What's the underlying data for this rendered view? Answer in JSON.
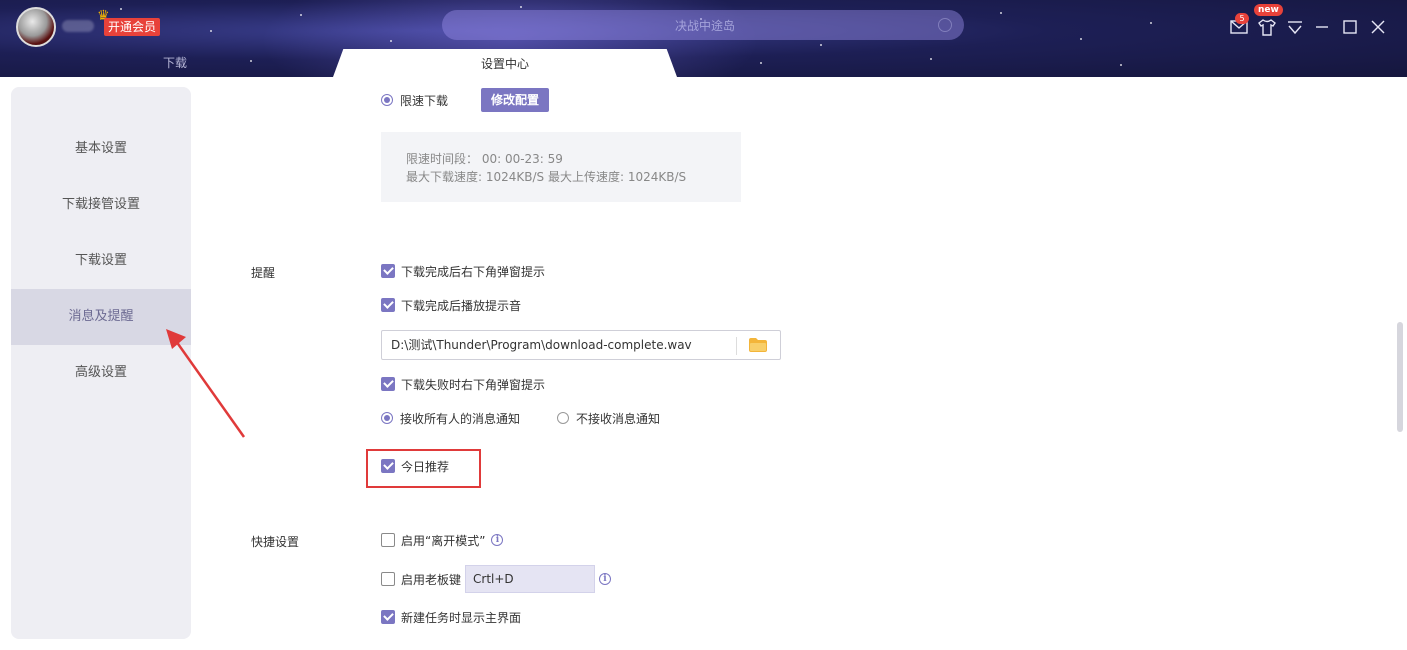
{
  "header": {
    "vip_label": "开通会员",
    "search_placeholder": "决战中途岛",
    "message_count": "5",
    "new_badge": "new"
  },
  "tabs": [
    {
      "label": "下载",
      "active": false
    },
    {
      "label": "设置中心",
      "active": true
    }
  ],
  "sidebar": {
    "items": [
      {
        "label": "基本设置",
        "active": false
      },
      {
        "label": "下载接管设置",
        "active": false
      },
      {
        "label": "下载设置",
        "active": false
      },
      {
        "label": "消息及提醒",
        "active": true
      },
      {
        "label": "高级设置",
        "active": false
      }
    ]
  },
  "speed": {
    "radio_label": "限速下载",
    "config_button": "修改配置",
    "time_range": "限速时间段： 00: 00-23: 59",
    "max_speeds": "最大下载速度: 1024KB/S   最大上传速度: 1024KB/S"
  },
  "reminders": {
    "section_label": "提醒",
    "popup_on_complete": "下载完成后右下角弹窗提示",
    "sound_on_complete": "下载完成后播放提示音",
    "sound_path": "D:\\测试\\Thunder\\Program\\download-complete.wav",
    "popup_on_fail": "下载失败时右下角弹窗提示",
    "receive_all": "接收所有人的消息通知",
    "receive_none": "不接收消息通知",
    "today_recommend": "今日推荐"
  },
  "shortcuts": {
    "section_label": "快捷设置",
    "away_mode": "启用“离开模式”",
    "boss_key": "启用老板键",
    "boss_key_value": "Crtl+D",
    "show_main_on_new": "新建任务时显示主界面"
  },
  "colors": {
    "accent": "#7b76c2",
    "highlight": "#e03a3a",
    "vip_red": "#e8423a"
  }
}
